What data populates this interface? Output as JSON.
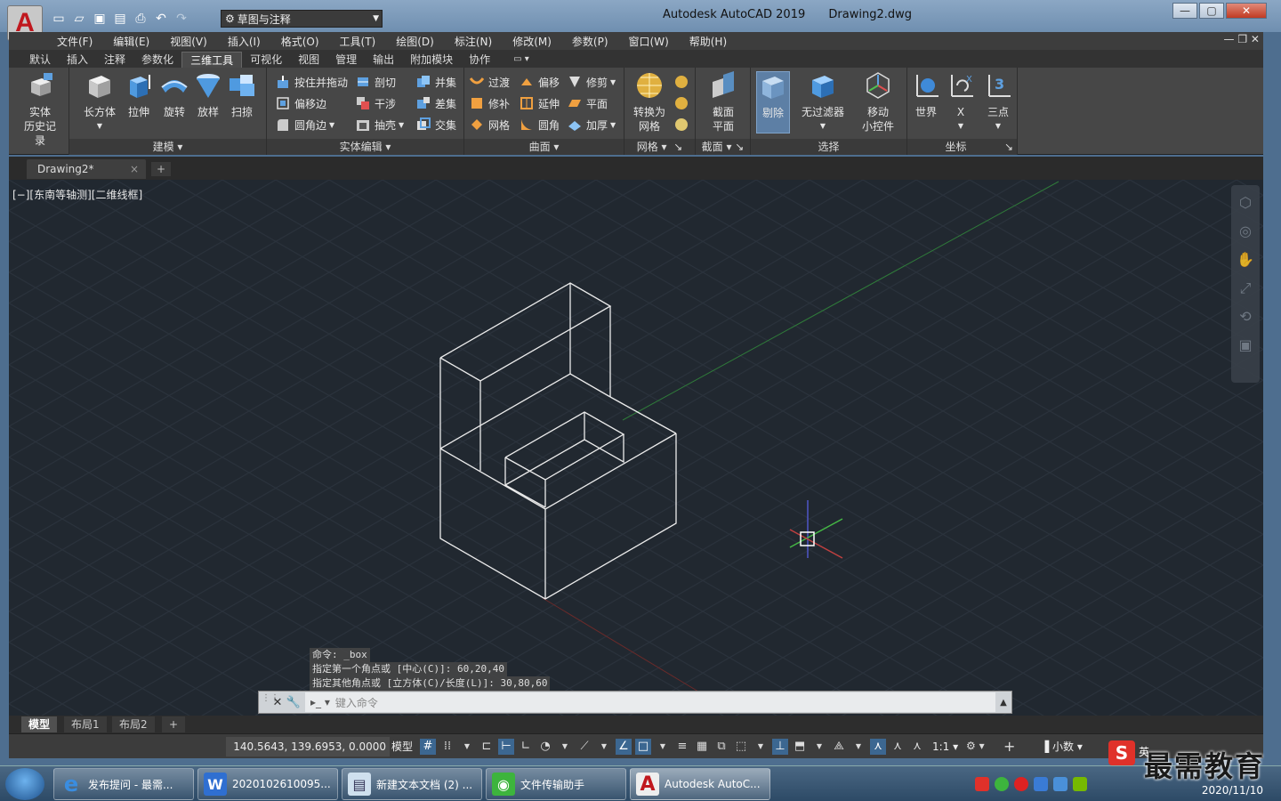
{
  "window": {
    "app_title": "Autodesk AutoCAD 2019",
    "file_title": "Drawing2.dwg",
    "workspace": "草图与注释"
  },
  "menu": [
    "文件(F)",
    "编辑(E)",
    "视图(V)",
    "插入(I)",
    "格式(O)",
    "工具(T)",
    "绘图(D)",
    "标注(N)",
    "修改(M)",
    "参数(P)",
    "窗口(W)",
    "帮助(H)"
  ],
  "ribbon_tabs": [
    "默认",
    "插入",
    "注释",
    "参数化",
    "三维工具",
    "可视化",
    "视图",
    "管理",
    "输出",
    "附加模块",
    "协作"
  ],
  "ribbon_active_tab": "三维工具",
  "ribbon": {
    "history_label_1": "实体",
    "history_label_2": "历史记录",
    "modeling": {
      "title": "建模",
      "box": "长方体",
      "extrude": "拉伸",
      "revolve": "旋转",
      "loft": "放样",
      "sweep": "扫掠"
    },
    "solid_edit": {
      "title": "实体编辑",
      "presspull": "按住并拖动",
      "offset_edge": "偏移边",
      "fillet_edge": "圆角边",
      "slice": "剖切",
      "interfere": "干涉",
      "shell": "抽壳",
      "union": "并集",
      "subtract": "差集",
      "intersect": "交集"
    },
    "surface": {
      "title": "曲面",
      "blend": "过渡",
      "offset": "偏移",
      "trim": "修剪",
      "patch": "修补",
      "extend": "延伸",
      "planar": "平面",
      "network": "网格",
      "fillet": "圆角",
      "thicken": "加厚"
    },
    "mesh": {
      "title": "网格",
      "convert_1": "转换为",
      "convert_2": "网格"
    },
    "section": {
      "title": "截面",
      "plane_1": "截面",
      "plane_2": "平面"
    },
    "selection": {
      "title": "选择",
      "cull": "剔除",
      "nofilter": "无过滤器",
      "gizmo_1": "移动",
      "gizmo_2": "小控件"
    },
    "ucs": {
      "title": "坐标",
      "world": "世界",
      "x": "X",
      "three_point": "三点"
    }
  },
  "doc_tab": {
    "name": "Drawing2*",
    "close": "×",
    "new": "+"
  },
  "viewport": {
    "label": "[−][东南等轴测][二维线框]"
  },
  "command": {
    "history": [
      "命令: _box",
      "指定第一个角点或 [中心(C)]: 60,20,40",
      "指定其他角点或 [立方体(C)/长度(L)]: 30,80,60"
    ],
    "placeholder": "键入命令"
  },
  "layout_tabs": {
    "model": "模型",
    "layout1": "布局1",
    "layout2": "布局2",
    "add": "+"
  },
  "status": {
    "coords": "140.5643, 139.6953, 0.0000",
    "model": "模型",
    "scale": "1:1",
    "units": "小数"
  },
  "taskbar": {
    "items": [
      "发布提问 - 最需...",
      "2020102610095...",
      "新建文本文档 (2) ...",
      "文件传输助手",
      "Autodesk AutoC..."
    ],
    "clock_date": "2020/11/10"
  },
  "watermark": {
    "text": "最需教育",
    "lang": "英"
  },
  "colors": {
    "viewport_bg": "#212830",
    "ribbon_bg": "#474747",
    "active_blue": "#5d7fa5",
    "autocad_red": "#c0181e"
  }
}
